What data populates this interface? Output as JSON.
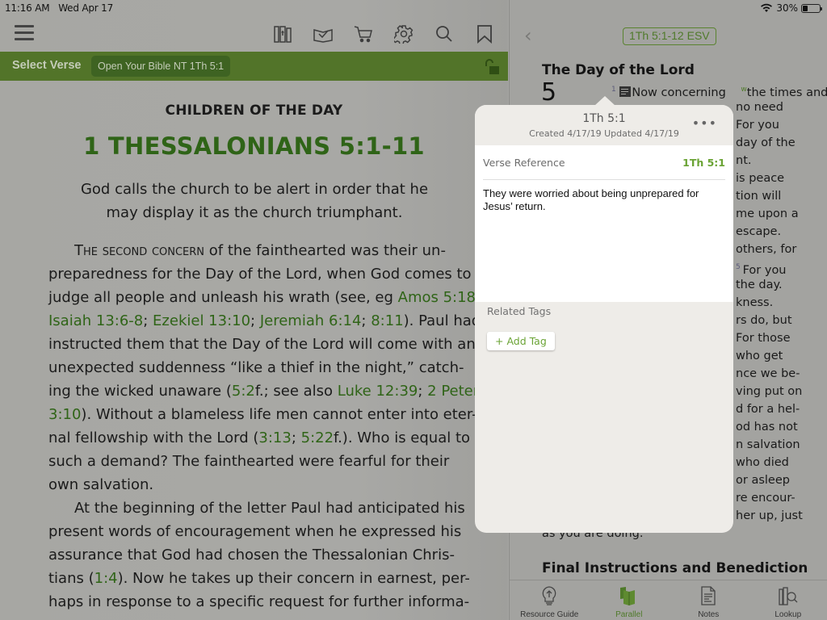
{
  "status_bar": {
    "time": "11:16 AM",
    "date": "Wed Apr 17",
    "battery": "30%",
    "battery_level_fraction": 0.3
  },
  "toolbar": {
    "icons": [
      "menu-icon",
      "library-icon",
      "reading-plan-icon",
      "store-cart-icon",
      "settings-gear-icon",
      "search-icon",
      "bookmark-icon"
    ]
  },
  "verse_bar": {
    "label": "Select Verse",
    "resource_pill": "Open Your Bible NT 1Th 5:1",
    "lock_state": "unlocked"
  },
  "left_content": {
    "section_title": "CHILDREN OF THE DAY",
    "main_title": "1 THESSALONIANS 5:1-11",
    "summary": "God calls the church to be alert in order that he may display it as the church triumphant.",
    "paragraph1": {
      "small_caps_lead": "The second concern",
      "lines": [
        [
          {
            "t": " of the fainthearted was their un-"
          }
        ],
        [
          {
            "t": "preparedness for the Day of the Lord, when God comes to"
          }
        ],
        [
          {
            "t": "judge all people and unleash his wrath (see, eg "
          },
          {
            "ref": "Amos 5:18"
          },
          {
            "t": ";"
          }
        ],
        [
          {
            "ref": "Isaiah 13:6-8"
          },
          {
            "t": "; "
          },
          {
            "ref": "Ezekiel 13:10"
          },
          {
            "t": "; "
          },
          {
            "ref": "Jeremiah 6:14"
          },
          {
            "t": "; "
          },
          {
            "ref": "8:11"
          },
          {
            "t": "). Paul had"
          }
        ],
        [
          {
            "t": "instructed them that the Day of the Lord will come with an"
          }
        ],
        [
          {
            "t": "unexpected suddenness “like a thief in the night,” catch-"
          }
        ],
        [
          {
            "t": "ing the wicked unaware ("
          },
          {
            "ref": "5:2"
          },
          {
            "t": "f.; see also "
          },
          {
            "ref": "Luke 12:39"
          },
          {
            "t": "; "
          },
          {
            "ref": "2 Peter"
          }
        ],
        [
          {
            "ref": "3:10"
          },
          {
            "t": "). Without a blameless life men cannot enter into eter-"
          }
        ],
        [
          {
            "t": "nal fellowship with the Lord ("
          },
          {
            "ref": "3:13"
          },
          {
            "t": "; "
          },
          {
            "ref": "5:22"
          },
          {
            "t": "f.). Who is equal to"
          }
        ],
        [
          {
            "t": "such a demand? The fainthearted were fearful for their"
          }
        ],
        [
          {
            "t": "own salvation."
          }
        ]
      ]
    },
    "paragraph2": {
      "lines": [
        [
          {
            "t": "At the beginning of the letter Paul had anticipated his"
          }
        ],
        [
          {
            "t": "present words of encouragement when he expressed his"
          }
        ],
        [
          {
            "t": "assurance that God had chosen the Thessalonian Chris-"
          }
        ],
        [
          {
            "t": "tians ("
          },
          {
            "ref": "1:4"
          },
          {
            "t": "). Now he takes up their concern in earnest, per-"
          }
        ],
        [
          {
            "t": "haps in response to a specific request for further informa-"
          }
        ]
      ]
    }
  },
  "right_pane": {
    "back_icon": "chevron-left-icon",
    "reference_badge": "1Th 5:1-12 ESV",
    "heading": "The Day of the Lord",
    "chapter_number": "5",
    "verse_1_number": "1",
    "first_line": "Now concerning",
    "first_line_tail": "the times and",
    "visible_line_fragments": [
      "no need",
      "For you",
      "day of the",
      "nt.",
      "is peace",
      "tion will",
      "me upon a",
      "escape.",
      "others, for",
      "For you",
      "the day.",
      "kness.",
      "rs do, but",
      "For those",
      "who get",
      "nce we be-",
      "ving put on",
      "d for a hel-",
      "od has not",
      "n salvation",
      "who died",
      "or asleep",
      "re encour-",
      "her up, just",
      "as you are doing."
    ],
    "verse_5_number": "5",
    "heading2": "Final Instructions and Benediction",
    "tabs": [
      {
        "label": "Resource Guide",
        "icon": "lightbulb-icon",
        "active": false
      },
      {
        "label": "Parallel",
        "icon": "parallel-books-icon",
        "active": true
      },
      {
        "label": "Notes",
        "icon": "notes-document-icon",
        "active": false
      },
      {
        "label": "Lookup",
        "icon": "lookup-books-magnifier-icon",
        "active": false
      }
    ]
  },
  "note_popover": {
    "title": "1Th 5:1",
    "subtitle": "Created 4/17/19 Updated 4/17/19",
    "more_label": "•••",
    "verse_reference_label": "Verse Reference",
    "verse_reference_value": "1Th 5:1",
    "note_text": "They were worried about being unprepared for Jesus’ return.",
    "related_tags_label": "Related Tags",
    "add_tag_label": "+ Add Tag"
  },
  "colors": {
    "accent_green": "#527429",
    "link_green": "#2f6417",
    "popover_green": "#6aa334"
  }
}
